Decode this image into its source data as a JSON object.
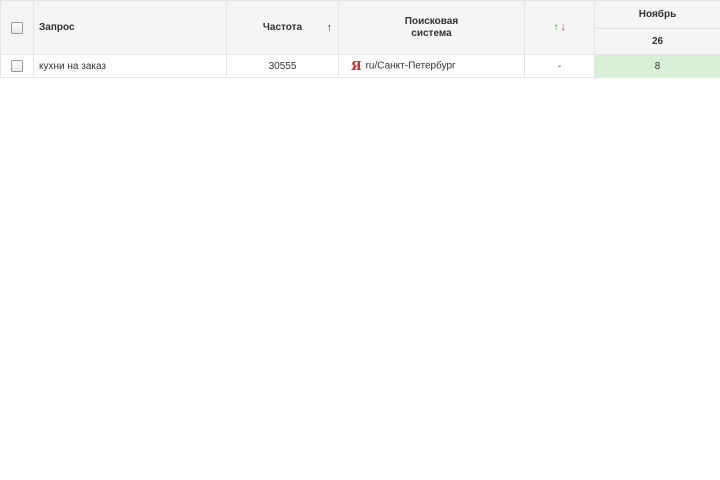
{
  "columns": {
    "query": "Запрос",
    "frequency": "Частота",
    "search_engine": "Поисковая система",
    "sort_arrow": "↑",
    "change_up": "↑",
    "change_down": "↓",
    "month": "Ноябрь",
    "day": "26"
  },
  "rows": [
    {
      "query": "кухни на заказ",
      "frequency": "30555",
      "engine_icon": "Я",
      "engine_region": "ru/Санкт-Петербург",
      "change": "-",
      "position": "8"
    }
  ],
  "colors": {
    "position_cell": "#d8f0d8",
    "up_arrow": "#2aa02a",
    "down_arrow": "#e0201e",
    "yandex_icon": "#e0201e"
  }
}
